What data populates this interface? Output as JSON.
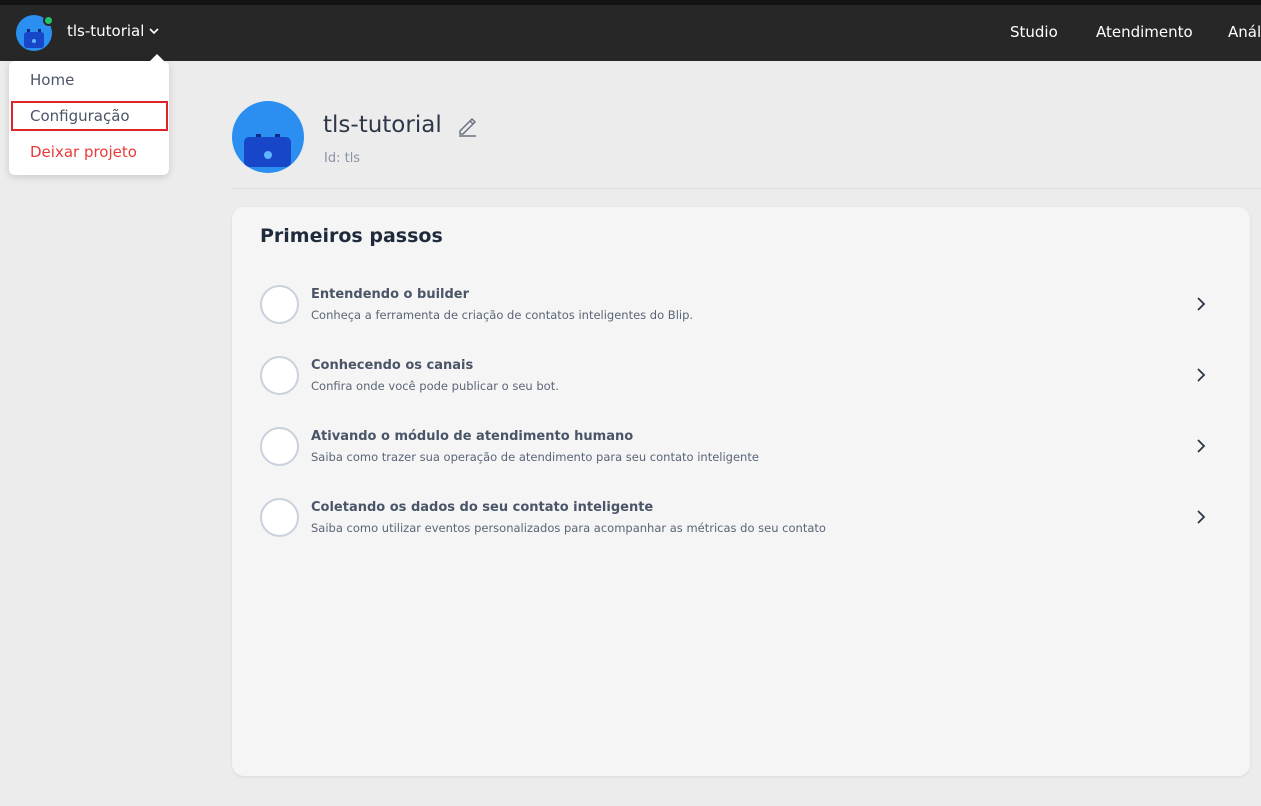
{
  "topbar": {
    "project_name": "tls-tutorial",
    "nav": [
      "Studio",
      "Atendimento",
      "Anál"
    ]
  },
  "dropdown": {
    "items": [
      {
        "label": "Home",
        "color": "#4a5568"
      },
      {
        "label": "Configuração",
        "color": "#4a5568"
      },
      {
        "label": "Deixar projeto",
        "color": "#e83a3a"
      }
    ]
  },
  "header": {
    "title": "tls-tutorial",
    "id_label": "Id: tls"
  },
  "card": {
    "title": "Primeiros passos",
    "steps": [
      {
        "title": "Entendendo o builder",
        "description": "Conheça a ferramenta de criação de contatos inteligentes do Blip."
      },
      {
        "title": "Conhecendo os canais",
        "description": "Confira onde você pode publicar o seu bot."
      },
      {
        "title": "Ativando o módulo de atendimento humano",
        "description": "Saiba como trazer sua operação de atendimento para seu contato inteligente"
      },
      {
        "title": "Coletando os dados do seu contato inteligente",
        "description": "Saiba como utilizar eventos personalizados para acompanhar as métricas do seu contato"
      }
    ]
  },
  "colors": {
    "topbar": "#272727",
    "online": "#21c46b",
    "danger": "#e83a3a",
    "highlight": "#e0242a",
    "avatar": "#2a8ff0"
  },
  "icons": [
    "bot-avatar-icon",
    "chevron-down-icon",
    "edit-pencil-icon",
    "chevron-right-icon",
    "step-status-circle-icon"
  ]
}
